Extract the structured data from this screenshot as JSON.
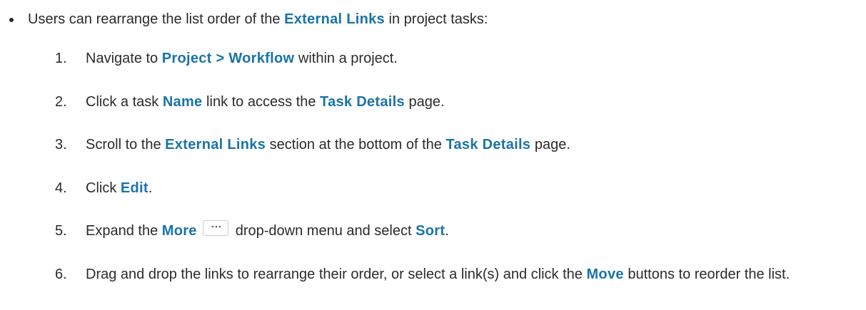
{
  "intro": {
    "pre": "Users can rearrange the list order of the ",
    "kw": "External Links",
    "post": " in project tasks:"
  },
  "steps": [
    {
      "num": "1.",
      "t1": "Navigate to ",
      "k1": "Project > Workflow",
      "t2": " within a project."
    },
    {
      "num": "2.",
      "t1": "Click a task ",
      "k1": "Name",
      "t2": " link to access the ",
      "k2": "Task Details",
      "t3": " page."
    },
    {
      "num": "3.",
      "t1": "Scroll to the ",
      "k1": "External Links",
      "t2": " section at the bottom of the ",
      "k2": "Task Details",
      "t3": " page."
    },
    {
      "num": "4.",
      "t1": "Click ",
      "k1": "Edit",
      "t2": "."
    },
    {
      "num": "5.",
      "t1": "Expand the ",
      "k1": "More",
      "t2": "drop-down menu and select ",
      "k2": "Sort",
      "t3": "."
    },
    {
      "num": "6.",
      "t1": "Drag and drop the links to rearrange their order, or select a link(s) and click the ",
      "k1": "Move",
      "t2": " buttons to reorder the list."
    }
  ],
  "colors": {
    "keyword": "#1a73a8",
    "text": "#2b2b2b"
  },
  "icons": {
    "more": "ellipsis-icon"
  }
}
